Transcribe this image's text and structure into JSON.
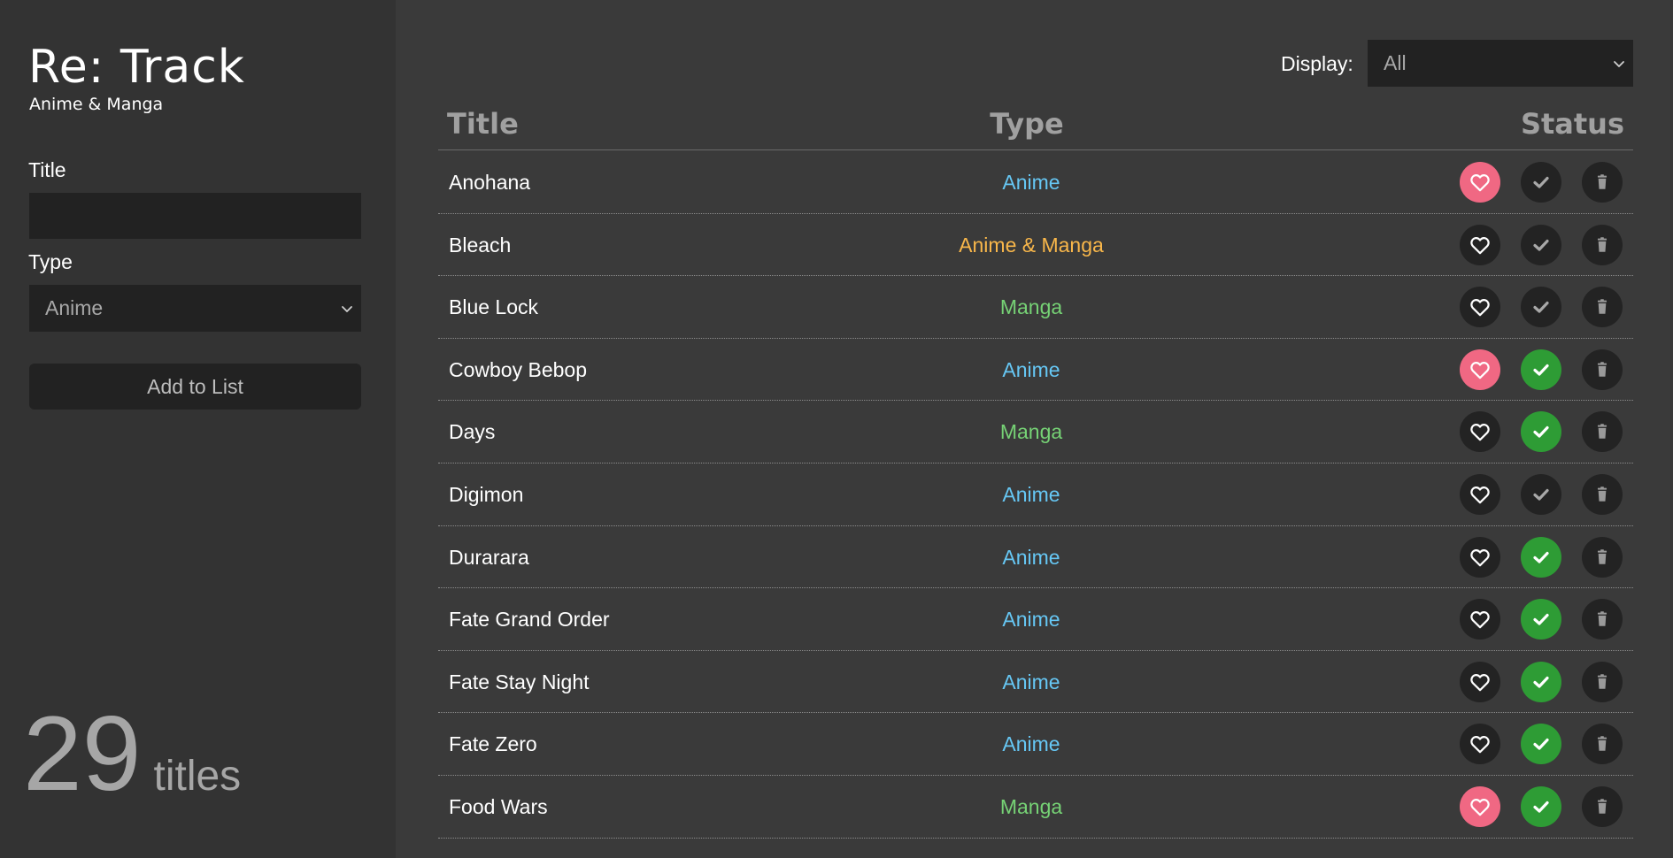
{
  "sidebar": {
    "app_title": "Re: Track",
    "app_subtitle": "Anime & Manga",
    "title_label": "Title",
    "title_value": "",
    "type_label": "Type",
    "type_selected": "Anime",
    "add_button": "Add to List",
    "count_number": "29",
    "count_label": "titles"
  },
  "toolbar": {
    "display_label": "Display:",
    "display_selected": "All"
  },
  "table": {
    "headers": {
      "title": "Title",
      "type": "Type",
      "status": "Status"
    },
    "rows": [
      {
        "title": "Anohana",
        "type": "Anime",
        "favorite": true,
        "completed": false
      },
      {
        "title": "Bleach",
        "type": "Anime & Manga",
        "favorite": false,
        "completed": false
      },
      {
        "title": "Blue Lock",
        "type": "Manga",
        "favorite": false,
        "completed": false
      },
      {
        "title": "Cowboy Bebop",
        "type": "Anime",
        "favorite": true,
        "completed": true
      },
      {
        "title": "Days",
        "type": "Manga",
        "favorite": false,
        "completed": true
      },
      {
        "title": "Digimon",
        "type": "Anime",
        "favorite": false,
        "completed": false
      },
      {
        "title": "Durarara",
        "type": "Anime",
        "favorite": false,
        "completed": true
      },
      {
        "title": "Fate Grand Order",
        "type": "Anime",
        "favorite": false,
        "completed": true
      },
      {
        "title": "Fate Stay Night",
        "type": "Anime",
        "favorite": false,
        "completed": true
      },
      {
        "title": "Fate Zero",
        "type": "Anime",
        "favorite": false,
        "completed": true
      },
      {
        "title": "Food Wars",
        "type": "Manga",
        "favorite": true,
        "completed": true
      }
    ]
  },
  "colors": {
    "favorite_active": "#f06883",
    "completed_active": "#2e9c35",
    "type_anime": "#66c7f4",
    "type_manga": "#76d275",
    "type_both": "#f9b74a"
  },
  "icons": {
    "favorite": "heart-icon",
    "completed": "check-icon",
    "delete": "trash-icon",
    "dropdown": "chevron-down-icon"
  }
}
